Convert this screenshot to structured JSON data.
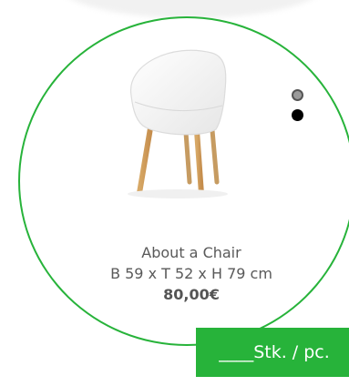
{
  "product": {
    "name": "About a Chair",
    "dimensions": "B 59 x T 52 x H 79 cm",
    "price": "80,00€"
  },
  "quantity": {
    "label": "____Stk. / pc."
  },
  "carousel": {
    "active_index": 1,
    "count": 2
  },
  "colors": {
    "accent_green": "#27b33a",
    "text_gray": "#595959"
  },
  "icons": {
    "product": "chair-image"
  }
}
